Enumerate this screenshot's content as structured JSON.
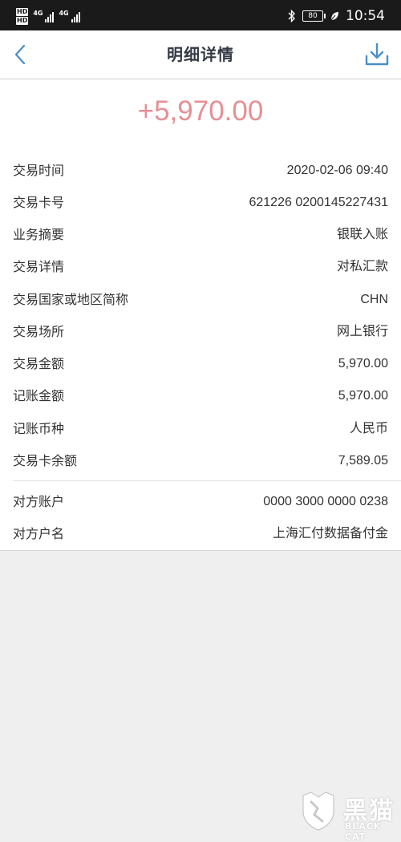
{
  "status_bar": {
    "network_top": "4G",
    "network_bottom": "4G",
    "hd_top": "HD",
    "hd_bottom": "HD",
    "battery": "80",
    "time": "10:54"
  },
  "header": {
    "title": "明细详情",
    "back_icon": "chevron-left-icon",
    "download_icon": "download-icon"
  },
  "amount": "+5,970.00",
  "details": [
    {
      "label": "交易时间",
      "value": "2020-02-06 09:40"
    },
    {
      "label": "交易卡号",
      "value": "621226 0200145227431"
    },
    {
      "label": "业务摘要",
      "value": "银联入账"
    },
    {
      "label": "交易详情",
      "value": "对私汇款"
    },
    {
      "label": "交易国家或地区简称",
      "value": "CHN"
    },
    {
      "label": "交易场所",
      "value": "网上银行"
    },
    {
      "label": "交易金额",
      "value": "5,970.00"
    },
    {
      "label": "记账金额",
      "value": "5,970.00"
    },
    {
      "label": "记账币种",
      "value": "人民币"
    },
    {
      "label": "交易卡余额",
      "value": "7,589.05"
    }
  ],
  "counterparty": [
    {
      "label": "对方账户",
      "value": "0000 3000 0000 0238"
    },
    {
      "label": "对方户名",
      "value": "上海汇付数据备付金"
    }
  ],
  "watermark": {
    "title": "黑猫",
    "subtitle": "BLACK CAT"
  },
  "colors": {
    "amount": "#e58f95",
    "accent": "#4a8fc6",
    "title": "#333a44",
    "background": "#efefef"
  }
}
